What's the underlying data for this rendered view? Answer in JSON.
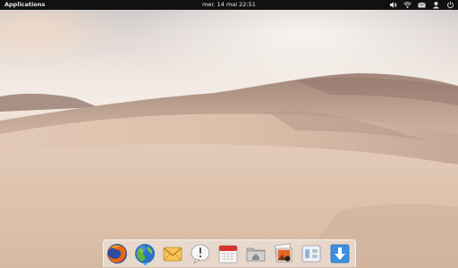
{
  "topbar": {
    "applications_label": "Applications",
    "clock_text": "mer. 14 mai 22:51",
    "indicators": [
      "volume-icon",
      "wifi-icon",
      "mail-icon",
      "user-icon",
      "power-icon"
    ]
  },
  "dock": {
    "items": [
      {
        "name": "firefox",
        "icon": "firefox-icon"
      },
      {
        "name": "midori",
        "icon": "web-browser-icon"
      },
      {
        "name": "mail",
        "icon": "mail-app-icon"
      },
      {
        "name": "messaging",
        "icon": "speech-bubble-icon"
      },
      {
        "name": "calendar",
        "icon": "calendar-icon"
      },
      {
        "name": "files",
        "icon": "folder-home-icon"
      },
      {
        "name": "photos",
        "icon": "photos-icon"
      },
      {
        "name": "settings",
        "icon": "system-settings-icon"
      },
      {
        "name": "downloads",
        "icon": "download-icon"
      }
    ],
    "running_item": "midori"
  }
}
